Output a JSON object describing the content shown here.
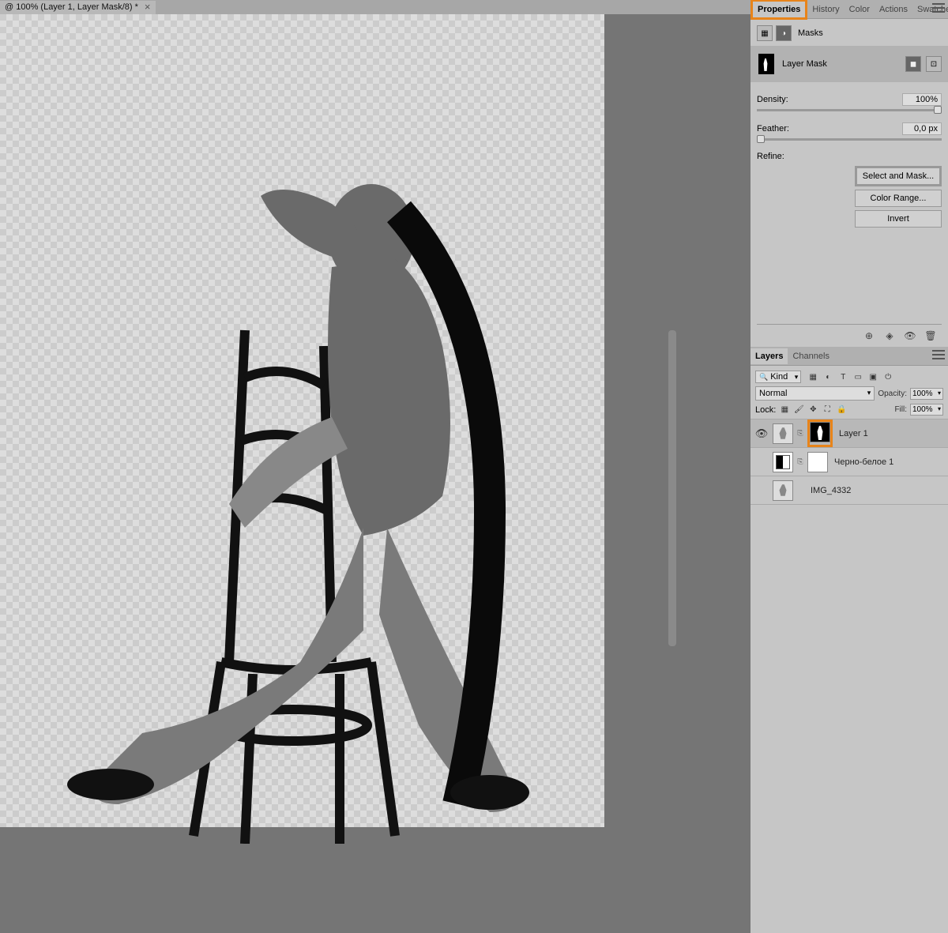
{
  "document_tab": {
    "title": "@ 100% (Layer 1, Layer Mask/8) *"
  },
  "right_panels": {
    "top_tabs": [
      "Properties",
      "History",
      "Color",
      "Actions",
      "Swatches"
    ],
    "top_active": "Properties",
    "properties": {
      "header_label": "Masks",
      "mask_label": "Layer Mask",
      "density_label": "Density:",
      "density_value": "100%",
      "feather_label": "Feather:",
      "feather_value": "0,0 px",
      "refine_label": "Refine:",
      "btn_select_mask": "Select and Mask...",
      "btn_color_range": "Color Range...",
      "btn_invert": "Invert"
    },
    "bottom_tabs": [
      "Layers",
      "Channels"
    ],
    "bottom_active": "Layers",
    "layers": {
      "kind_label": "Kind",
      "blend_mode": "Normal",
      "opacity_label": "Opacity:",
      "opacity_value": "100%",
      "lock_label": "Lock:",
      "fill_label": "Fill:",
      "fill_value": "100%",
      "items": [
        {
          "name": "Layer 1",
          "visible": true,
          "has_mask": true,
          "selected": true
        },
        {
          "name": "Черно-белое 1",
          "visible": false,
          "is_adjustment": true,
          "has_mask": true
        },
        {
          "name": "IMG_4332",
          "visible": false,
          "has_mask": false
        }
      ]
    }
  }
}
